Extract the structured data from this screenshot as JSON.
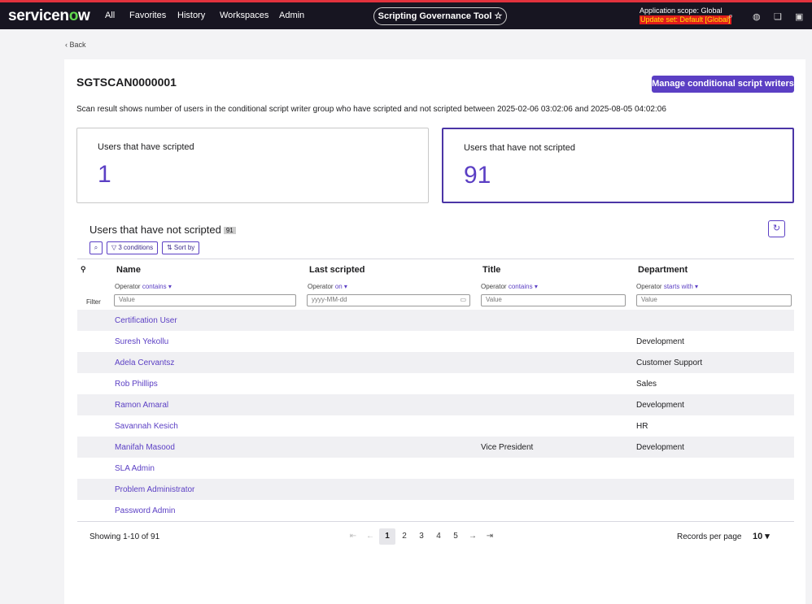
{
  "nav": {
    "logo_a": "servicen",
    "logo_o": "o",
    "logo_b": "w",
    "items": [
      "All",
      "Favorites",
      "History",
      "Workspaces",
      "Admin"
    ],
    "center": "Scripting Governance Tool",
    "star": "☆",
    "scope": "Application scope: Global",
    "update_set": "Update set: Default [Global]"
  },
  "back": "‹ Back",
  "header": {
    "id": "SGTSCAN0000001",
    "manage": "Manage conditional script writers",
    "description": "Scan result shows number of users in the conditional script writer group who have scripted and not scripted between 2025-02-06 03:02:06 and 2025-08-05 04:02:06"
  },
  "stats": [
    {
      "label": "Users that have scripted",
      "value": "1"
    },
    {
      "label": "Users that have not scripted",
      "value": "91"
    }
  ],
  "list": {
    "title": "Users that have not scripted",
    "count": "91",
    "conditions": "▽ 3 conditions",
    "sort": "⇅ Sort by",
    "filter_label": "Filter",
    "columns": [
      {
        "name": "Name",
        "op_label": "Operator",
        "op": "contains ▾",
        "placeholder": "Value"
      },
      {
        "name": "Last scripted",
        "op_label": "Operator",
        "op": "on ▾",
        "placeholder": "yyyy-MM-dd"
      },
      {
        "name": "Title",
        "op_label": "Operator",
        "op": "contains ▾",
        "placeholder": "Value"
      },
      {
        "name": "Department",
        "op_label": "Operator",
        "op": "starts with ▾",
        "placeholder": "Value"
      }
    ],
    "rows": [
      {
        "name": "Certification User",
        "last": "",
        "title": "",
        "dept": ""
      },
      {
        "name": "Suresh Yekollu",
        "last": "",
        "title": "",
        "dept": "Development"
      },
      {
        "name": "Adela Cervantsz",
        "last": "",
        "title": "",
        "dept": "Customer Support"
      },
      {
        "name": "Rob Phillips",
        "last": "",
        "title": "",
        "dept": "Sales"
      },
      {
        "name": "Ramon Amaral",
        "last": "",
        "title": "",
        "dept": "Development"
      },
      {
        "name": "Savannah Kesich",
        "last": "",
        "title": "",
        "dept": "HR"
      },
      {
        "name": "Manifah Masood",
        "last": "",
        "title": "Vice President",
        "dept": "Development"
      },
      {
        "name": "SLA Admin",
        "last": "",
        "title": "",
        "dept": ""
      },
      {
        "name": "Problem Administrator",
        "last": "",
        "title": "",
        "dept": ""
      },
      {
        "name": "Password Admin",
        "last": "",
        "title": "",
        "dept": ""
      }
    ]
  },
  "footer": {
    "showing": "Showing 1-10 of 91",
    "pages": [
      "1",
      "2",
      "3",
      "4",
      "5"
    ],
    "first": "⇤",
    "prev": "←",
    "next": "→",
    "last": "⇥",
    "rpp_label": "Records per page",
    "rpp": "10 ▾"
  }
}
